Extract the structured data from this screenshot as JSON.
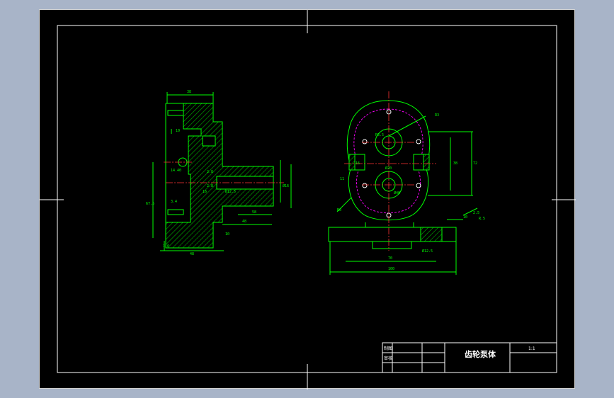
{
  "title_block": {
    "drawing_title": "齿轮泵体",
    "scale": "1:1",
    "row1_label": "制图",
    "row2_label": "审核"
  },
  "left_view_dims": [
    "38",
    "10",
    "14.40",
    "2.8",
    "2.8",
    "3.4",
    "67.5",
    "16",
    "48",
    "48",
    "58",
    "10",
    "3.6",
    "Ø16",
    "Ø12.5"
  ],
  "right_view_dims": [
    "R3.5",
    "R3",
    "11",
    "Ø20",
    "72",
    "38",
    "16",
    "Ø48",
    "R0",
    "10",
    "2.5",
    "70",
    "100",
    "Ø12.5",
    "R.5"
  ],
  "colors": {
    "paper": "#000000",
    "background": "#a8b4c8",
    "lines": "#00ff00",
    "border": "#ffffff",
    "centerline": "#ff3333",
    "bolt_circle": "#ff00ff"
  }
}
